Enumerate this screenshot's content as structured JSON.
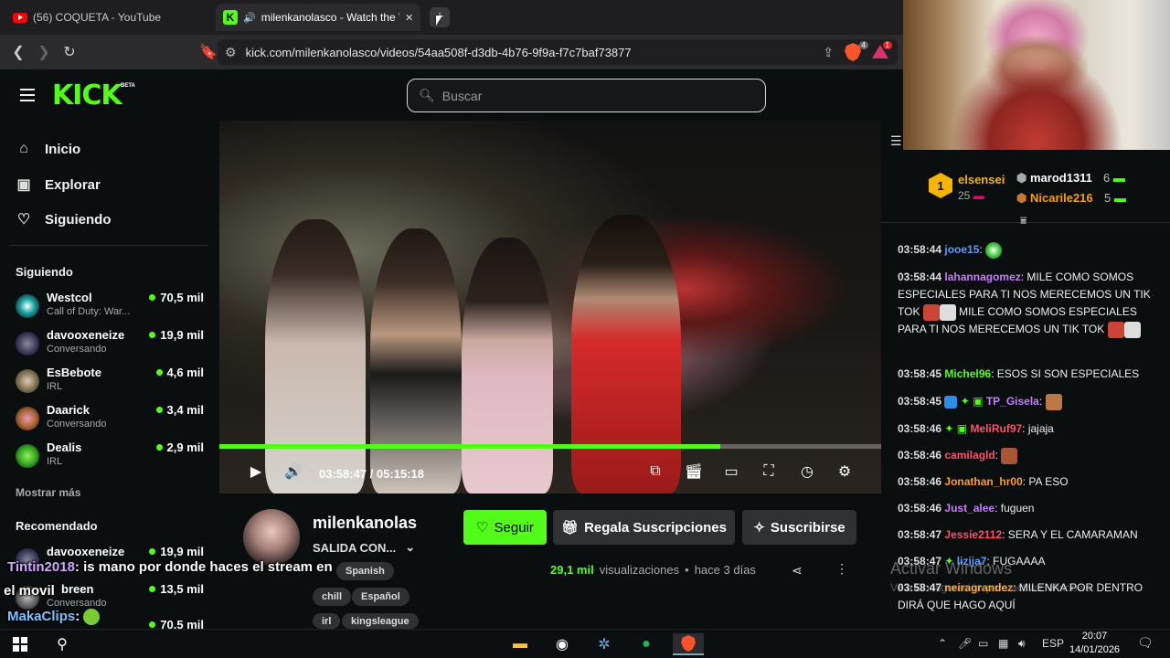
{
  "browser": {
    "tabs": [
      {
        "title": "(56) COQUETA - YouTube"
      },
      {
        "title": "milenkanolasco - Watch the V"
      }
    ],
    "new_tab": "+",
    "url": "kick.com/milenkanolasco/videos/54aa508f-d3db-4b76-9f9a-f7c7baf73877",
    "brave_badge": "4",
    "rewards_badge": "1"
  },
  "header": {
    "logo": "KICK",
    "logo_badge": "BETA",
    "search_placeholder": "Buscar"
  },
  "sidebar": {
    "nav": [
      {
        "label": "Inicio",
        "icon": "home-icon"
      },
      {
        "label": "Explorar",
        "icon": "explore-icon"
      },
      {
        "label": "Siguiendo",
        "icon": "heart-icon"
      }
    ],
    "following_heading": "Siguiendo",
    "following": [
      {
        "name": "Westcol",
        "category": "Call of Duty: War...",
        "viewers": "70,5 mil"
      },
      {
        "name": "davooxeneize",
        "category": "Conversando",
        "viewers": "19,9 mil"
      },
      {
        "name": "EsBebote",
        "category": "IRL",
        "viewers": "4,6 mil"
      },
      {
        "name": "Daarick",
        "category": "Conversando",
        "viewers": "3,4 mil"
      },
      {
        "name": "Dealis",
        "category": "IRL",
        "viewers": "2,9 mil"
      }
    ],
    "show_more": "Mostrar más",
    "recommended_heading": "Recomendado",
    "recommended": [
      {
        "name": "davooxeneize",
        "category": "",
        "viewers": "19,9 mil"
      },
      {
        "name": "breen",
        "category": "Conversando",
        "viewers": "13,5 mil"
      },
      {
        "name": "",
        "category": "",
        "viewers": "70,5 mil"
      }
    ]
  },
  "player": {
    "progress": 0.757,
    "current_time": "03:58:47",
    "separator": "/",
    "duration": "05:15:18"
  },
  "video_info": {
    "streamer": "milenkanolas",
    "title": "SALIDA CON...",
    "follow_label": "Seguir",
    "gift_label": "Regala Suscripciones",
    "subscribe_label": "Suscribirse",
    "views_count": "29,1 mil",
    "views_label": "visualizaciones",
    "age": "hace 3 días",
    "tags": [
      "Spanish",
      "chill",
      "Español",
      "irl",
      "kingsleague"
    ]
  },
  "overlay_chat": [
    {
      "user": "Tintin2018",
      "text": ": is mano por donde haces el stream en"
    },
    {
      "user": "",
      "text": "el movil"
    },
    {
      "user": "MakaClips",
      "text": ":"
    }
  ],
  "leaderboard": {
    "first": {
      "rank": "1",
      "name": "elsensei",
      "count": "25"
    },
    "second": {
      "name": "marod1311",
      "count": "6"
    },
    "third": {
      "name": "Nicarile216",
      "count": "5"
    }
  },
  "chat": [
    {
      "time": "03:58:44",
      "user": "jooe15",
      "color": "#5b9cff",
      "text": ":"
    },
    {
      "time": "03:58:44",
      "user": "lahannagomez",
      "color": "#c77dff",
      "text": ": MILE COMO SOMOS ESPECIALES PARA TI NOS MERECEMOS UN TIK TOK",
      "text2": "MILE COMO SOMOS ESPECIALES PARA TI NOS MERECEMOS UN TIK TOK"
    },
    {
      "time": "03:58:45",
      "user": "Michel96",
      "color": "#53fc18",
      "text": ": ESOS SI SON ESPECIALES"
    },
    {
      "time": "03:58:45",
      "user": "TP_Gisela",
      "color": "#c77dff",
      "text": ":"
    },
    {
      "time": "03:58:46",
      "user": "MeliRuf97",
      "color": "#ff4d6d",
      "text": ": jajaja"
    },
    {
      "time": "03:58:46",
      "user": "camilagld",
      "color": "#ff4d6d",
      "text": ":"
    },
    {
      "time": "03:58:46",
      "user": "Jonathan_hr00",
      "color": "#ff9f1c",
      "text": ": PA ESO"
    },
    {
      "time": "03:58:46",
      "user": "Just_alee",
      "color": "#c77dff",
      "text": ": fuguen"
    },
    {
      "time": "03:58:47",
      "user": "Jessie2112",
      "color": "#ff4d6d",
      "text": ": SERA Y EL CAMARAMAN"
    },
    {
      "time": "03:58:47",
      "user": "lizija7",
      "color": "#5b9cff",
      "text": ": FUGAAAA"
    },
    {
      "time": "03:58:47",
      "user": "neiragrandez",
      "color": "#ff9f1c",
      "text": ": MILENKA POR DENTRO DIRÁ QUE HAGO AQUÍ"
    }
  ],
  "windows_watermark": {
    "line1": "Activar Windows",
    "line2": "Ve a Configuración para activar Windows."
  },
  "taskbar": {
    "language": "ESP",
    "time": "20:07",
    "date": "14/01/2026"
  },
  "colors": {
    "kick_green": "#53fc18",
    "background": "#0b0e0f"
  }
}
